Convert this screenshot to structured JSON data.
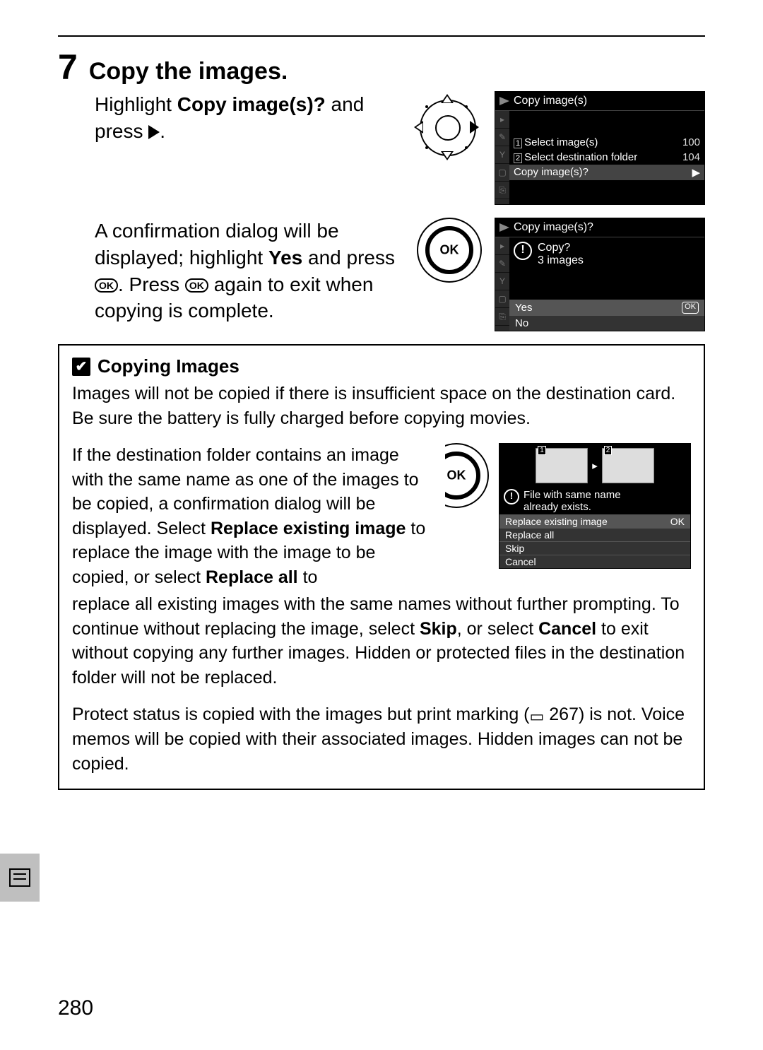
{
  "step": {
    "number": "7",
    "title": "Copy the images.",
    "para1_a": "Highlight ",
    "para1_b": "Copy image(s)?",
    "para1_c": " and press ",
    "para2_a": "A confirmation dialog will be displayed; highlight ",
    "para2_b": "Yes",
    "para2_c": " and press ",
    "para2_d": ".  Press ",
    "para2_e": " again to exit when copying is complete."
  },
  "lcd1": {
    "title": "Copy image(s)",
    "rows": [
      {
        "slot": "1",
        "label": "Select image(s)",
        "val": "100",
        "hi": false
      },
      {
        "slot": "2",
        "label": "Select destination folder",
        "val": "104",
        "hi": false
      },
      {
        "slot": "",
        "label": "Copy image(s)?",
        "val": "▶",
        "hi": true
      }
    ]
  },
  "lcd2": {
    "title": "Copy image(s)?",
    "prompt_line1": "Copy?",
    "prompt_line2": "3  images",
    "yes": "Yes",
    "no": "No",
    "ok": "OK"
  },
  "ok_label": "OK",
  "note": {
    "heading": "Copying Images",
    "p1": "Images will not be copied if there is insufficient space on the destination card.  Be sure the battery is fully charged before copying movies.",
    "p2_a": "If the destination folder contains an image with the same name as one of the images to be copied, a confirmation dialog will be displayed.  Select ",
    "p2_b": "Replace existing image",
    "p2_c": " to replace the image with the image to be copied, or select ",
    "p2_d": "Replace all",
    "p2_e": " to",
    "p2_cont_a": "replace all existing images with the same names without further prompting.  To continue without replacing the image, select ",
    "p2_cont_b": "Skip",
    "p2_cont_c": ", or select ",
    "p2_cont_d": "Cancel",
    "p2_cont_e": " to exit without copying any further images. Hidden or protected files in the destination folder will not be replaced.",
    "p3_a": "Protect status is copied with the images but print marking (",
    "p3_page": " 267",
    "p3_b": ") is not.  Voice memos will be copied with their associated images. Hidden images can not be copied."
  },
  "lcd3": {
    "slot1": "1",
    "slot2": "2",
    "msg_l1": "File with same name",
    "msg_l2": "already exists.",
    "opts": [
      {
        "label": "Replace existing image",
        "hi": true,
        "ok": true
      },
      {
        "label": "Replace all",
        "hi": false,
        "ok": false
      },
      {
        "label": "Skip",
        "hi": false,
        "ok": false
      },
      {
        "label": "Cancel",
        "hi": false,
        "ok": false
      }
    ],
    "ok": "OK"
  },
  "page_number": "280"
}
